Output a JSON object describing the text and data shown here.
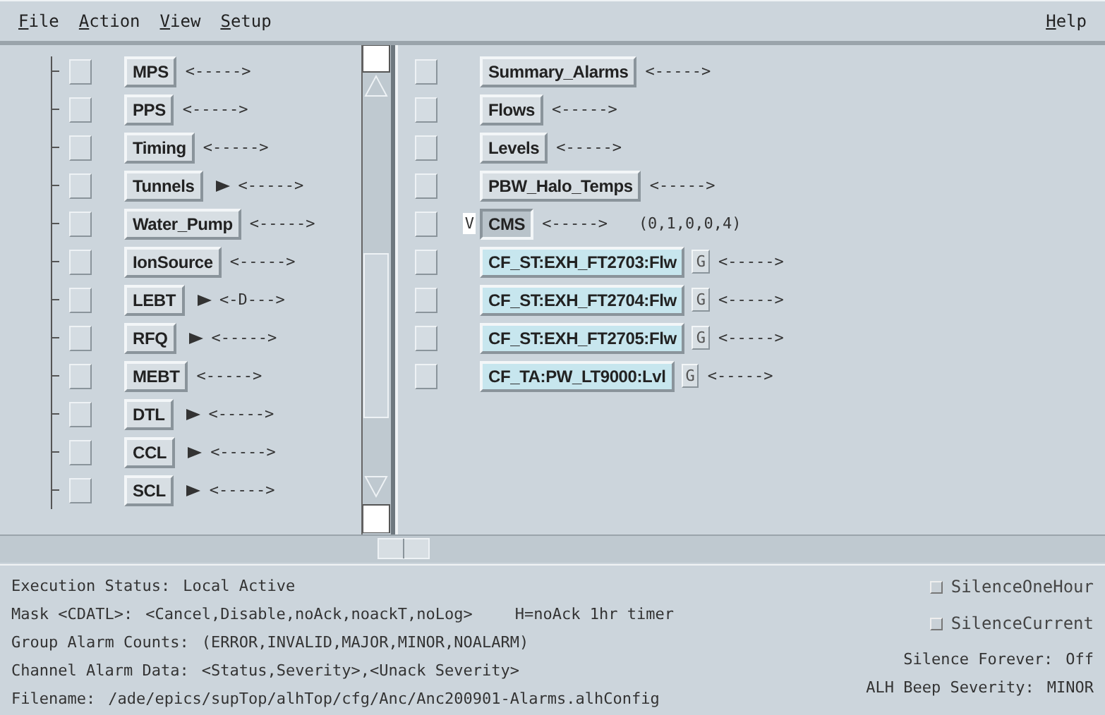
{
  "menu": [
    {
      "label": "File"
    },
    {
      "label": "Action"
    },
    {
      "label": "View"
    },
    {
      "label": "Setup"
    }
  ],
  "help_menu": {
    "label": "Help"
  },
  "group_tree": {
    "items": [
      {
        "label": "MPS",
        "mask": "<----->",
        "expandable": false,
        "checked": false
      },
      {
        "label": "PPS",
        "mask": "<----->",
        "expandable": false,
        "checked": false
      },
      {
        "label": "Timing",
        "mask": "<----->",
        "expandable": false,
        "checked": false
      },
      {
        "label": "Tunnels",
        "mask": "<----->",
        "expandable": true,
        "checked": false
      },
      {
        "label": "Water_Pump",
        "mask": "<----->",
        "expandable": false,
        "checked": false
      },
      {
        "label": "IonSource",
        "mask": "<----->",
        "expandable": false,
        "checked": false
      },
      {
        "label": "LEBT",
        "mask": "<-D--->",
        "expandable": true,
        "checked": false
      },
      {
        "label": "RFQ",
        "mask": "<----->",
        "expandable": true,
        "checked": false
      },
      {
        "label": "MEBT",
        "mask": "<----->",
        "expandable": false,
        "checked": false
      },
      {
        "label": "DTL",
        "mask": "<----->",
        "expandable": true,
        "checked": false
      },
      {
        "label": "CCL",
        "mask": "<----->",
        "expandable": true,
        "checked": false
      },
      {
        "label": "SCL",
        "mask": "<----->",
        "expandable": true,
        "checked": false
      }
    ]
  },
  "alarm_list": {
    "items": [
      {
        "kind": "group",
        "label": "Summary_Alarms",
        "mask": "<----->",
        "selected": false,
        "checked": false
      },
      {
        "kind": "group",
        "label": "Flows",
        "mask": "<----->",
        "selected": false,
        "checked": false
      },
      {
        "kind": "group",
        "label": "Levels",
        "mask": "<----->",
        "selected": false,
        "checked": false
      },
      {
        "kind": "group",
        "label": "PBW_Halo_Temps",
        "mask": "<----->",
        "selected": false,
        "checked": false
      },
      {
        "kind": "group",
        "label": "CMS",
        "mask": "<----->",
        "selected": true,
        "checked": false,
        "flag": "V",
        "counts": "(0,1,0,0,4)"
      },
      {
        "kind": "channel",
        "label": "CF_ST:EXH_FT2703:Flw",
        "guidance": "G",
        "mask": "<----->",
        "selected": false,
        "checked": false
      },
      {
        "kind": "channel",
        "label": "CF_ST:EXH_FT2704:Flw",
        "guidance": "G",
        "mask": "<----->",
        "selected": false,
        "checked": false
      },
      {
        "kind": "channel",
        "label": "CF_ST:EXH_FT2705:Flw",
        "guidance": "G",
        "mask": "<----->",
        "selected": false,
        "checked": false
      },
      {
        "kind": "channel",
        "label": "CF_TA:PW_LT9000:Lvl",
        "guidance": "G",
        "mask": "<----->",
        "selected": false,
        "checked": false
      }
    ]
  },
  "status": {
    "lines": [
      {
        "label": "Execution Status:",
        "value": "Local Active"
      },
      {
        "label": "Mask <CDATL>:",
        "value": "<Cancel,Disable,noAck,noackT,noLog>",
        "note": "H=noAck 1hr timer"
      },
      {
        "label": "Group Alarm Counts:",
        "value": "(ERROR,INVALID,MAJOR,MINOR,NOALARM)"
      },
      {
        "label": "Channel Alarm Data:",
        "value": "<Status,Severity>,<Unack Severity>"
      },
      {
        "label": "Filename:",
        "value": "/ade/epics/supTop/alhTop/cfg/Anc/Anc200901-Alarms.alhConfig"
      }
    ],
    "toggles": [
      {
        "label": "SilenceOneHour",
        "checked": false
      },
      {
        "label": "SilenceCurrent",
        "checked": false
      }
    ],
    "silence_forever": {
      "label": "Silence Forever:",
      "value": "Off"
    },
    "beep_severity": {
      "label": "ALH Beep Severity:",
      "value": "MINOR"
    }
  }
}
